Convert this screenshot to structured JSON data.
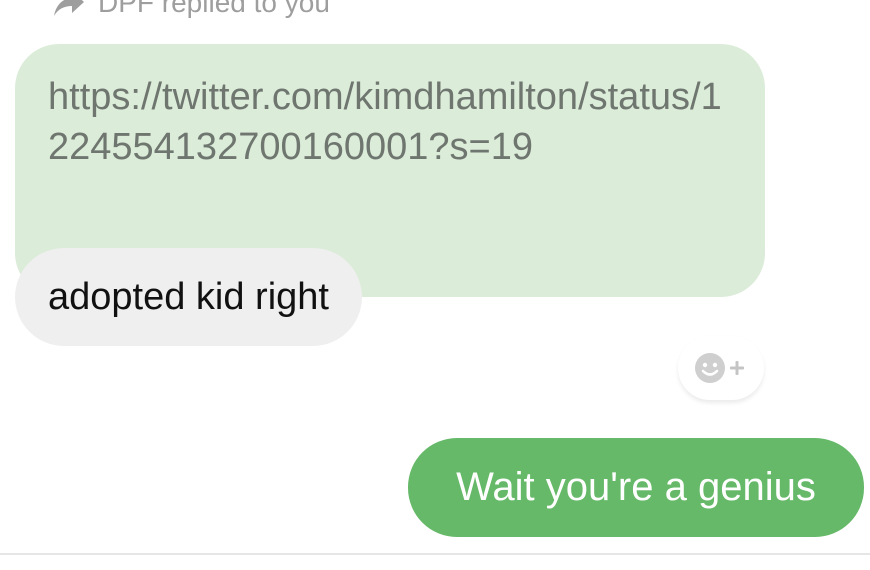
{
  "reply_header": {
    "icon": "reply-arrow-icon",
    "text": "DPF replied to you"
  },
  "quoted_message": {
    "text": "https://twitter.com/kimdhamilton/status/1224554132700160001?s=19",
    "color": "#dbecd9"
  },
  "reply_message": {
    "text": "adopted kid right"
  },
  "reaction_button": {
    "icon": "add-reaction-icon"
  },
  "sent_message": {
    "text": "Wait you're a genius",
    "color": "#66b968"
  }
}
